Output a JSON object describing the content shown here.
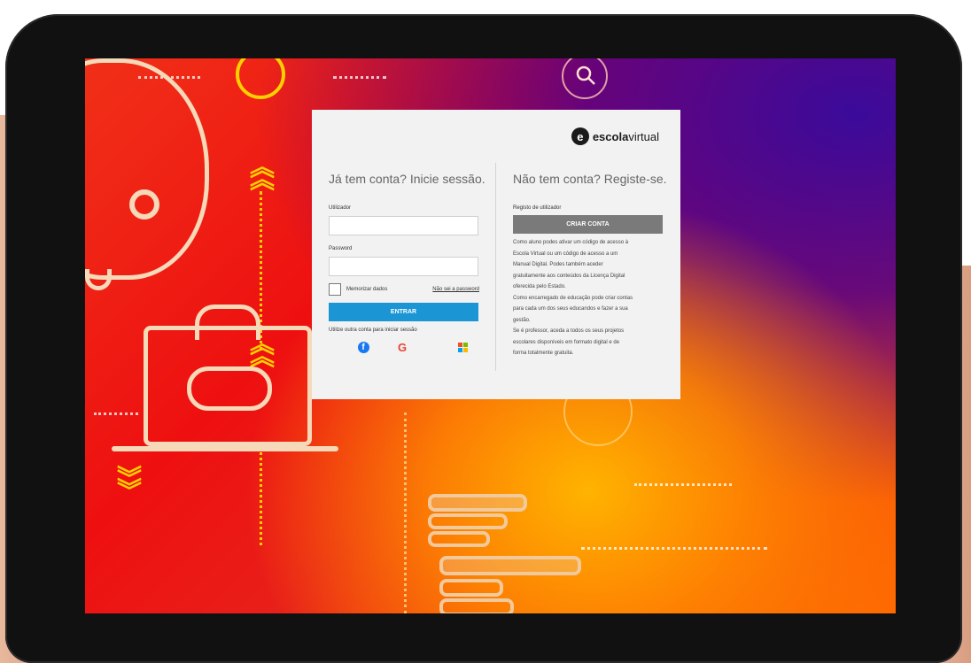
{
  "logo": {
    "mark": "e",
    "brand_bold": "escola",
    "brand_regular": "virtual"
  },
  "login": {
    "heading": "Já tem conta? Inicie sessão.",
    "username_label": "Utilizador",
    "password_label": "Password",
    "remember_label": "Memorizar dados",
    "forgot_link": "Não sei a password",
    "enter_button": "ENTRAR",
    "other_account_label": "Utilize outra conta para iniciar sessão",
    "social": [
      {
        "name": "facebook",
        "icon": "facebook-icon",
        "glyph": "f"
      },
      {
        "name": "google",
        "icon": "google-icon",
        "glyph": "G"
      },
      {
        "name": "microsoft",
        "icon": "microsoft-icon"
      }
    ]
  },
  "register": {
    "heading": "Não tem conta? Registe-se.",
    "label": "Registo de utilizador",
    "create_button": "CRIAR CONTA",
    "info": "Como aluno podes ativar um código de acesso à\nEscola Virtual ou um código de acesso a um\nManual Digital. Podes também aceder\ngratuitamente aos conteúdos da Licença Digital\noferecida pelo Estado.\nComo encarregado de educação pode criar contas\npara cada um dos seus educandos e fazer a sua\ngestão.\nSe é professor, aceda a todos os seus projetos\nescolares disponíveis em formato digital e de\nforma totalmente gratuita."
  },
  "colors": {
    "enter_button": "#1b95d4",
    "create_button": "#7a7a7a",
    "card_background": "#f2f2f2"
  }
}
